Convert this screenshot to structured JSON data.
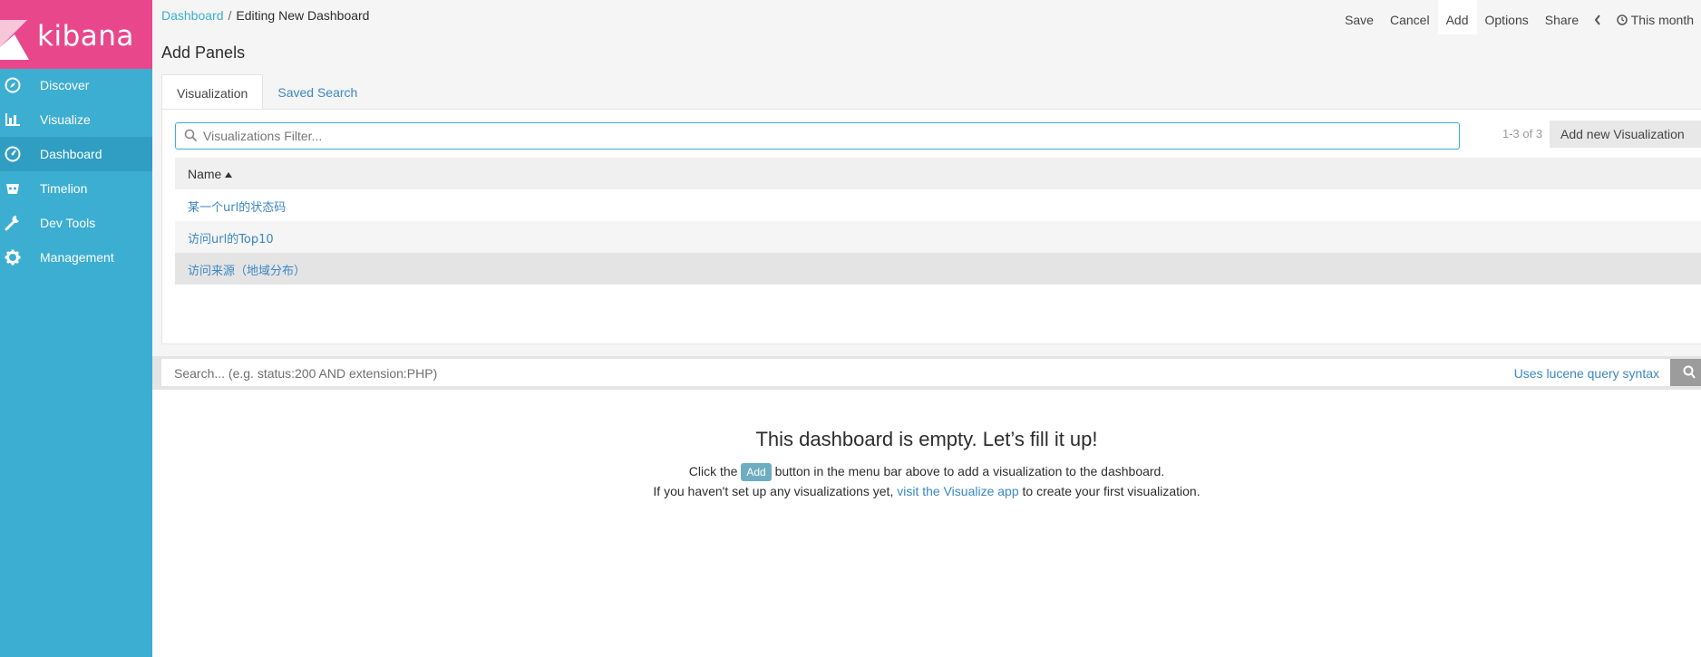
{
  "brand": {
    "name": "kibana",
    "accent": "#e8488b",
    "sidebar_color": "#3caed2"
  },
  "sidebar": {
    "items": [
      {
        "label": "Discover",
        "icon": "compass-icon"
      },
      {
        "label": "Visualize",
        "icon": "bar-chart-icon"
      },
      {
        "label": "Dashboard",
        "icon": "dashboard-icon",
        "active": true
      },
      {
        "label": "Timelion",
        "icon": "timelion-icon"
      },
      {
        "label": "Dev Tools",
        "icon": "wrench-icon"
      },
      {
        "label": "Management",
        "icon": "gear-icon"
      }
    ]
  },
  "header": {
    "breadcrumb_link": "Dashboard",
    "breadcrumb_sep": "/",
    "breadcrumb_current": "Editing New Dashboard",
    "menu": {
      "save": "Save",
      "cancel": "Cancel",
      "add": "Add",
      "options": "Options",
      "share": "Share",
      "time": "This month"
    }
  },
  "add_panels": {
    "title": "Add Panels",
    "tabs": [
      {
        "label": "Visualization",
        "active": true
      },
      {
        "label": "Saved Search"
      }
    ],
    "filter_placeholder": "Visualizations Filter...",
    "count": "1-3 of 3",
    "add_new_label": "Add new Visualization",
    "column_header": "Name",
    "rows": [
      "某一个url的状态码",
      "访问url的Top10",
      "访问来源（地域分布）"
    ]
  },
  "query": {
    "placeholder": "Search... (e.g. status:200 AND extension:PHP)",
    "syntax_link": "Uses lucene query syntax"
  },
  "empty_state": {
    "title": "This dashboard is empty. Let’s fill it up!",
    "line1_before": "Click the",
    "line1_button": "Add",
    "line1_after": "button in the menu bar above to add a visualization to the dashboard.",
    "line2_before": "If you haven't set up any visualizations yet,",
    "line2_link": "visit the Visualize app",
    "line2_after": "to create your first visualization."
  }
}
